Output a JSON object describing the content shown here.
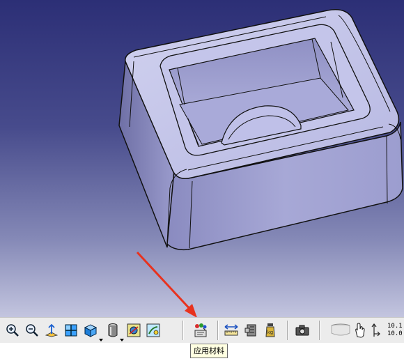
{
  "app": {
    "tooltip": "应用材料"
  },
  "toolbar": {
    "buttons": [
      {
        "id": "zoom-in",
        "icon": "zoom-in-icon"
      },
      {
        "id": "zoom-out",
        "icon": "zoom-out-icon"
      },
      {
        "id": "normal-view",
        "icon": "normal-view-icon"
      },
      {
        "id": "multi-view",
        "icon": "multi-view-icon"
      },
      {
        "id": "iso-view",
        "icon": "iso-view-icon"
      },
      {
        "id": "shading",
        "icon": "shading-icon"
      },
      {
        "id": "hide-show",
        "icon": "hide-show-icon"
      },
      {
        "id": "swap-visible",
        "icon": "swap-visible-icon"
      },
      {
        "id": "apply-material",
        "icon": "apply-material-icon"
      },
      {
        "id": "measure-between",
        "icon": "measure-between-icon"
      },
      {
        "id": "measure-item",
        "icon": "measure-item-icon"
      },
      {
        "id": "measure-inertia",
        "icon": "measure-inertia-icon"
      },
      {
        "id": "capture",
        "icon": "camera-icon"
      },
      {
        "id": "compass",
        "icon": "compass-icon"
      },
      {
        "id": "hand",
        "icon": "hand-icon"
      },
      {
        "id": "axis",
        "icon": "axis-icon"
      }
    ],
    "coord_top": "10.1",
    "coord_bottom": "10.0"
  },
  "colors": {
    "viewport_top": "#2c2f76",
    "viewport_bottom": "#c3c5df",
    "annotation_arrow": "#e8321e",
    "part_face": "#b2b3dc"
  }
}
